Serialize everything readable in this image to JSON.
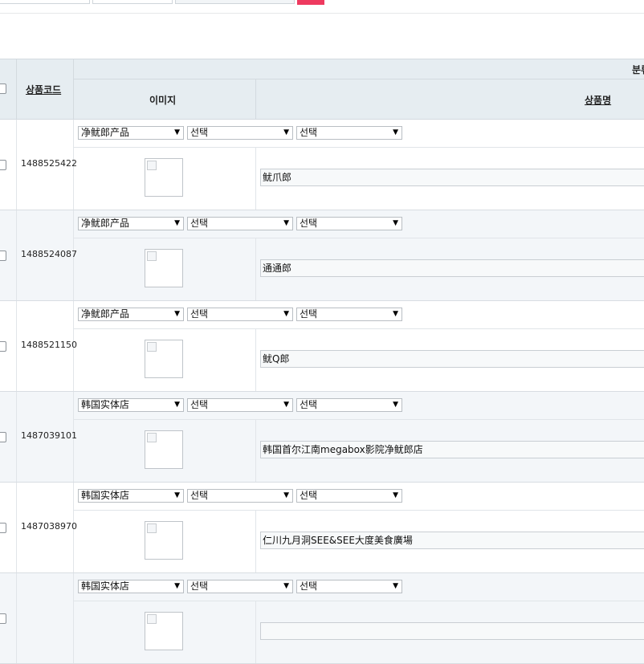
{
  "header": {
    "product_code": "상품코드",
    "category": "분류",
    "image": "이미지",
    "product_name": "상품명"
  },
  "rows": [
    {
      "code": "1488525422",
      "cat1": "净鱿郎产品",
      "cat2": "선택",
      "cat3": "선택",
      "name": "鱿爪郎"
    },
    {
      "code": "1488524087",
      "cat1": "净鱿郎产品",
      "cat2": "선택",
      "cat3": "선택",
      "name": "通通郎"
    },
    {
      "code": "1488521150",
      "cat1": "净鱿郎产品",
      "cat2": "선택",
      "cat3": "선택",
      "name": "鱿Q郎"
    },
    {
      "code": "1487039101",
      "cat1": "韩国实体店",
      "cat2": "선택",
      "cat3": "선택",
      "name": "韩国首尔江南megabox影院净鱿郎店"
    },
    {
      "code": "1487038970",
      "cat1": "韩国实体店",
      "cat2": "선택",
      "cat3": "선택",
      "name": "仁川九月洞SEE&SEE大度美食廣場"
    },
    {
      "code": "",
      "cat1": "韩国实体店",
      "cat2": "선택",
      "cat3": "선택",
      "name": ""
    }
  ],
  "colors": {
    "accent": "#ee3a5f",
    "header_bg": "#e6edf1",
    "row_alt": "#f3f6f9"
  },
  "icons": {
    "dropdown": "caret-down-icon",
    "image": "broken-image-icon"
  }
}
